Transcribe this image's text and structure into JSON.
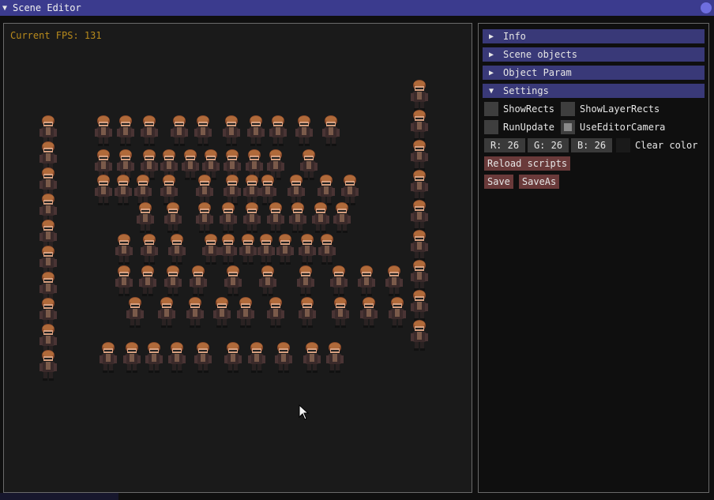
{
  "window": {
    "title": "Scene Editor",
    "collapse_icon": "triangle-down-icon",
    "close_icon": "circle-close-icon"
  },
  "viewport": {
    "fps_label": "Current FPS: 131",
    "sprite_icon": "character-sprite-icon"
  },
  "sidepanel": {
    "headers": {
      "info": "Info",
      "scene_objects": "Scene objects",
      "object_param": "Object Param",
      "settings": "Settings"
    },
    "settings": {
      "show_rects": {
        "label": "ShowRects",
        "checked": false
      },
      "show_layer_rects": {
        "label": "ShowLayerRects",
        "checked": false
      },
      "run_update": {
        "label": "RunUpdate",
        "checked": false
      },
      "use_editor_camera": {
        "label": "UseEditorCamera",
        "checked": true
      },
      "clear_color": {
        "r": "R: 26",
        "g": "G: 26",
        "b": "B: 26",
        "label": "Clear color",
        "value": "#1a1a1a"
      },
      "reload_scripts": "Reload scripts",
      "save": "Save",
      "save_as": "SaveAs"
    }
  },
  "colors": {
    "title_bar": "#3b3b8e",
    "header": "#393978",
    "button": "#6a3a3a",
    "fps_text": "#b88a1c"
  }
}
